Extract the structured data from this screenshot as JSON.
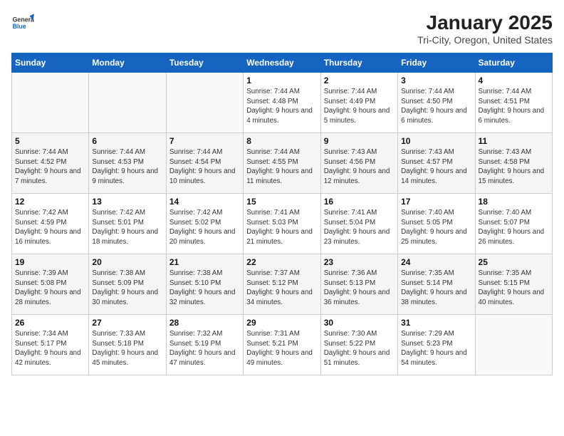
{
  "header": {
    "logo_general": "General",
    "logo_blue": "Blue",
    "title": "January 2025",
    "subtitle": "Tri-City, Oregon, United States"
  },
  "days_of_week": [
    "Sunday",
    "Monday",
    "Tuesday",
    "Wednesday",
    "Thursday",
    "Friday",
    "Saturday"
  ],
  "weeks": [
    [
      {
        "day": "",
        "info": ""
      },
      {
        "day": "",
        "info": ""
      },
      {
        "day": "",
        "info": ""
      },
      {
        "day": "1",
        "info": "Sunrise: 7:44 AM\nSunset: 4:48 PM\nDaylight: 9 hours and 4 minutes."
      },
      {
        "day": "2",
        "info": "Sunrise: 7:44 AM\nSunset: 4:49 PM\nDaylight: 9 hours and 5 minutes."
      },
      {
        "day": "3",
        "info": "Sunrise: 7:44 AM\nSunset: 4:50 PM\nDaylight: 9 hours and 6 minutes."
      },
      {
        "day": "4",
        "info": "Sunrise: 7:44 AM\nSunset: 4:51 PM\nDaylight: 9 hours and 6 minutes."
      }
    ],
    [
      {
        "day": "5",
        "info": "Sunrise: 7:44 AM\nSunset: 4:52 PM\nDaylight: 9 hours and 7 minutes."
      },
      {
        "day": "6",
        "info": "Sunrise: 7:44 AM\nSunset: 4:53 PM\nDaylight: 9 hours and 9 minutes."
      },
      {
        "day": "7",
        "info": "Sunrise: 7:44 AM\nSunset: 4:54 PM\nDaylight: 9 hours and 10 minutes."
      },
      {
        "day": "8",
        "info": "Sunrise: 7:44 AM\nSunset: 4:55 PM\nDaylight: 9 hours and 11 minutes."
      },
      {
        "day": "9",
        "info": "Sunrise: 7:43 AM\nSunset: 4:56 PM\nDaylight: 9 hours and 12 minutes."
      },
      {
        "day": "10",
        "info": "Sunrise: 7:43 AM\nSunset: 4:57 PM\nDaylight: 9 hours and 14 minutes."
      },
      {
        "day": "11",
        "info": "Sunrise: 7:43 AM\nSunset: 4:58 PM\nDaylight: 9 hours and 15 minutes."
      }
    ],
    [
      {
        "day": "12",
        "info": "Sunrise: 7:42 AM\nSunset: 4:59 PM\nDaylight: 9 hours and 16 minutes."
      },
      {
        "day": "13",
        "info": "Sunrise: 7:42 AM\nSunset: 5:01 PM\nDaylight: 9 hours and 18 minutes."
      },
      {
        "day": "14",
        "info": "Sunrise: 7:42 AM\nSunset: 5:02 PM\nDaylight: 9 hours and 20 minutes."
      },
      {
        "day": "15",
        "info": "Sunrise: 7:41 AM\nSunset: 5:03 PM\nDaylight: 9 hours and 21 minutes."
      },
      {
        "day": "16",
        "info": "Sunrise: 7:41 AM\nSunset: 5:04 PM\nDaylight: 9 hours and 23 minutes."
      },
      {
        "day": "17",
        "info": "Sunrise: 7:40 AM\nSunset: 5:05 PM\nDaylight: 9 hours and 25 minutes."
      },
      {
        "day": "18",
        "info": "Sunrise: 7:40 AM\nSunset: 5:07 PM\nDaylight: 9 hours and 26 minutes."
      }
    ],
    [
      {
        "day": "19",
        "info": "Sunrise: 7:39 AM\nSunset: 5:08 PM\nDaylight: 9 hours and 28 minutes."
      },
      {
        "day": "20",
        "info": "Sunrise: 7:38 AM\nSunset: 5:09 PM\nDaylight: 9 hours and 30 minutes."
      },
      {
        "day": "21",
        "info": "Sunrise: 7:38 AM\nSunset: 5:10 PM\nDaylight: 9 hours and 32 minutes."
      },
      {
        "day": "22",
        "info": "Sunrise: 7:37 AM\nSunset: 5:12 PM\nDaylight: 9 hours and 34 minutes."
      },
      {
        "day": "23",
        "info": "Sunrise: 7:36 AM\nSunset: 5:13 PM\nDaylight: 9 hours and 36 minutes."
      },
      {
        "day": "24",
        "info": "Sunrise: 7:35 AM\nSunset: 5:14 PM\nDaylight: 9 hours and 38 minutes."
      },
      {
        "day": "25",
        "info": "Sunrise: 7:35 AM\nSunset: 5:15 PM\nDaylight: 9 hours and 40 minutes."
      }
    ],
    [
      {
        "day": "26",
        "info": "Sunrise: 7:34 AM\nSunset: 5:17 PM\nDaylight: 9 hours and 42 minutes."
      },
      {
        "day": "27",
        "info": "Sunrise: 7:33 AM\nSunset: 5:18 PM\nDaylight: 9 hours and 45 minutes."
      },
      {
        "day": "28",
        "info": "Sunrise: 7:32 AM\nSunset: 5:19 PM\nDaylight: 9 hours and 47 minutes."
      },
      {
        "day": "29",
        "info": "Sunrise: 7:31 AM\nSunset: 5:21 PM\nDaylight: 9 hours and 49 minutes."
      },
      {
        "day": "30",
        "info": "Sunrise: 7:30 AM\nSunset: 5:22 PM\nDaylight: 9 hours and 51 minutes."
      },
      {
        "day": "31",
        "info": "Sunrise: 7:29 AM\nSunset: 5:23 PM\nDaylight: 9 hours and 54 minutes."
      },
      {
        "day": "",
        "info": ""
      }
    ]
  ]
}
